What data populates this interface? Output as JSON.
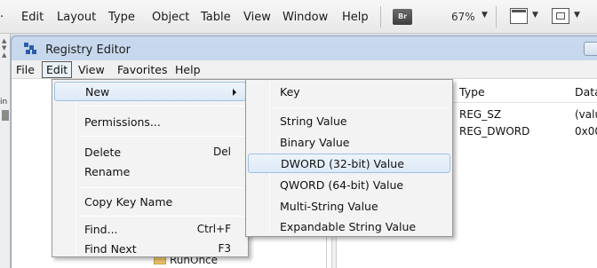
{
  "app_menubar": {
    "items": [
      "Edit",
      "Layout",
      "Type",
      "Object",
      "Table",
      "View",
      "Window",
      "Help"
    ],
    "br_badge": "Br",
    "zoom": "67%"
  },
  "left_strip": {
    "label": "in"
  },
  "registry": {
    "title": "Registry Editor",
    "menu": [
      "File",
      "Edit",
      "View",
      "Favorites",
      "Help"
    ],
    "columns": {
      "type": "Type",
      "data": "Data"
    },
    "rows": [
      {
        "type": "REG_SZ",
        "data": "(valu"
      },
      {
        "type": "REG_DWORD",
        "data": "0x00"
      }
    ],
    "tree_partial_label": "RunOnce"
  },
  "edit_menu": {
    "new": "New",
    "permissions": "Permissions...",
    "delete": "Delete",
    "delete_shortcut": "Del",
    "rename": "Rename",
    "copy_key_name": "Copy Key Name",
    "find": "Find...",
    "find_shortcut": "Ctrl+F",
    "find_next": "Find Next",
    "find_next_shortcut": "F3"
  },
  "new_submenu": {
    "items": [
      "Key",
      "String Value",
      "Binary Value",
      "DWORD (32-bit) Value",
      "QWORD (64-bit) Value",
      "Multi-String Value",
      "Expandable String Value"
    ],
    "highlighted": "DWORD (32-bit) Value"
  }
}
